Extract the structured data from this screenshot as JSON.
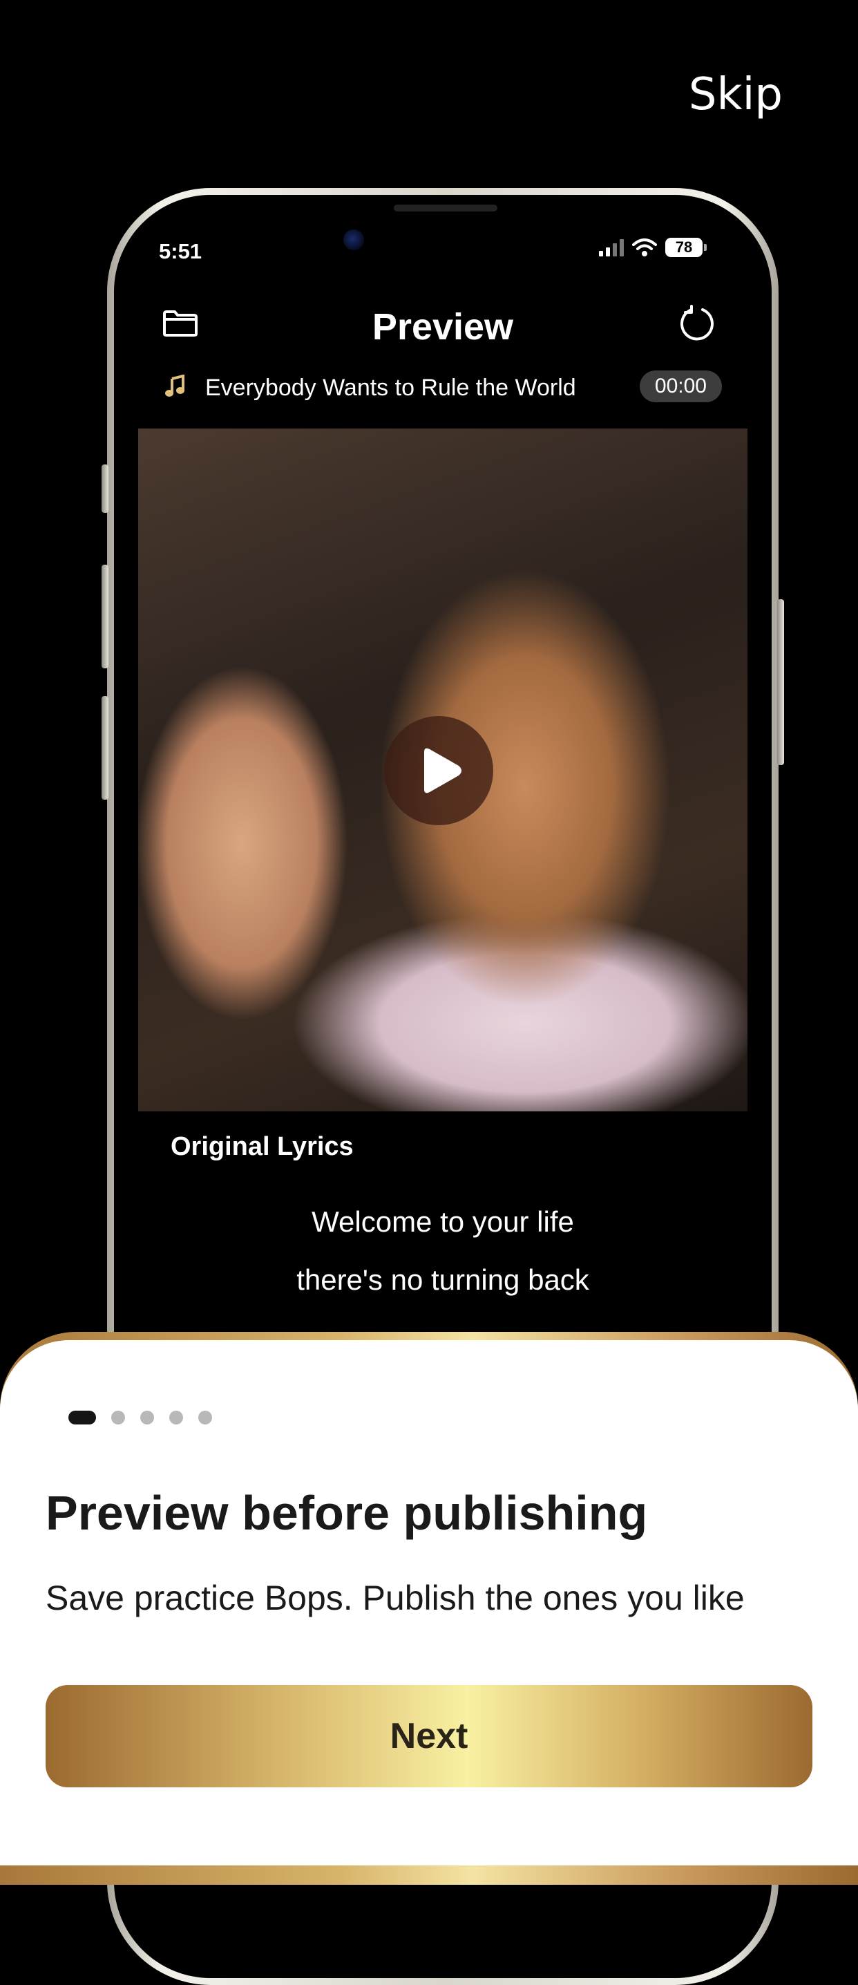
{
  "skip_label": "Skip",
  "phone": {
    "status_time": "5:51",
    "battery": "78",
    "header_title": "Preview",
    "song_title": "Everybody Wants to Rule the World",
    "song_time": "00:00",
    "lyrics_label": "Original Lyrics",
    "lyrics": [
      "Welcome to your life",
      "there's no turning back"
    ]
  },
  "sheet": {
    "page_count": 5,
    "active_page": 1,
    "title": "Preview before publishing",
    "subtitle": "Save practice Bops. Publish the ones you like",
    "next_label": "Next"
  },
  "colors": {
    "background": "#000000",
    "sheet_background": "#ffffff",
    "gold_light": "#f8f0a2",
    "gold_dark": "#9b6a30",
    "time_badge": "#3d3d3d"
  },
  "icons": [
    "folder-icon",
    "refresh-icon",
    "music-note-icon",
    "play-icon",
    "signal-icon",
    "wifi-icon",
    "battery-icon"
  ]
}
